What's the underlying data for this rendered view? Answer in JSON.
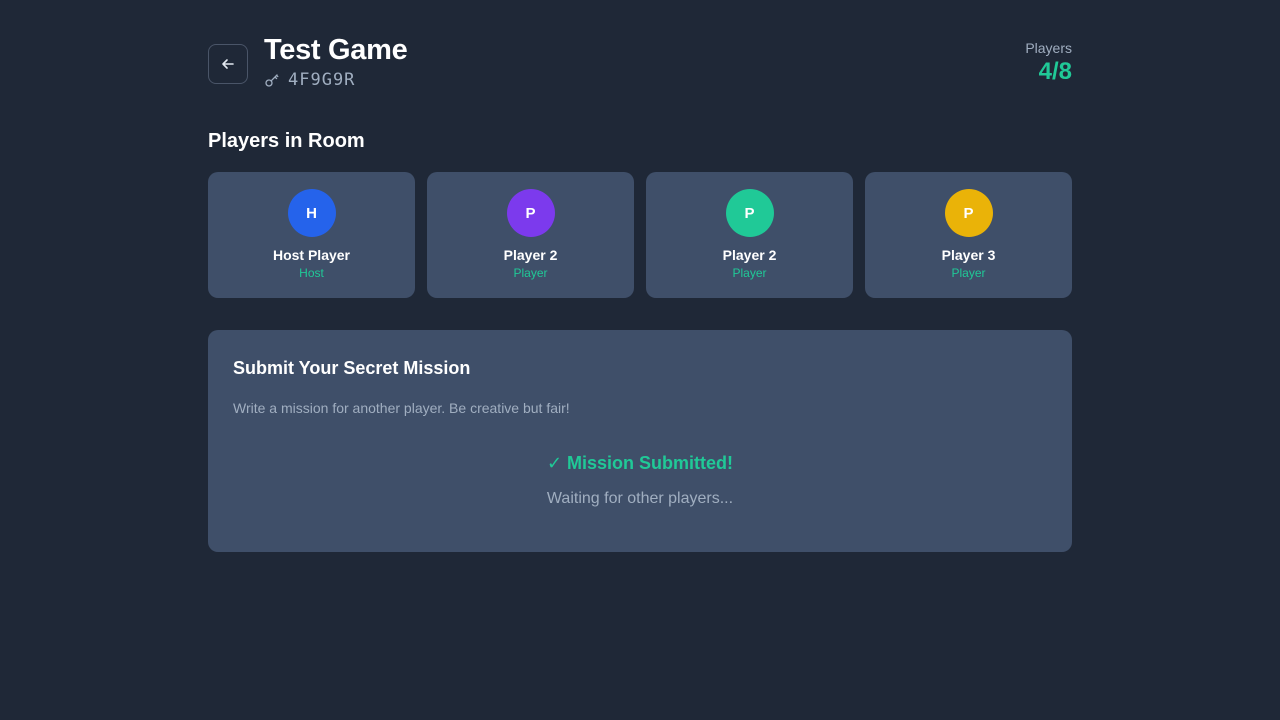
{
  "header": {
    "title": "Test Game",
    "room_code": "4F9G9R",
    "back_icon": "arrow-left-icon",
    "code_icon": "key-icon",
    "players_label": "Players",
    "players_value": "4/8"
  },
  "players_section": {
    "title": "Players in Room",
    "players": [
      {
        "initial": "H",
        "name": "Host Player",
        "role": "Host",
        "color": "#2563eb"
      },
      {
        "initial": "P",
        "name": "Player 2",
        "role": "Player",
        "color": "#7c3aed"
      },
      {
        "initial": "P",
        "name": "Player 2",
        "role": "Player",
        "color": "#20c997"
      },
      {
        "initial": "P",
        "name": "Player 3",
        "role": "Player",
        "color": "#eab308"
      }
    ]
  },
  "mission": {
    "title": "Submit Your Secret Mission",
    "description": "Write a mission for another player. Be creative but fair!",
    "status": "✓ Mission Submitted!",
    "waiting": "Waiting for other players..."
  },
  "colors": {
    "background": "#1f2837",
    "card": "#3f4f69",
    "accent": "#20c997",
    "muted_text": "#a0aec0"
  }
}
